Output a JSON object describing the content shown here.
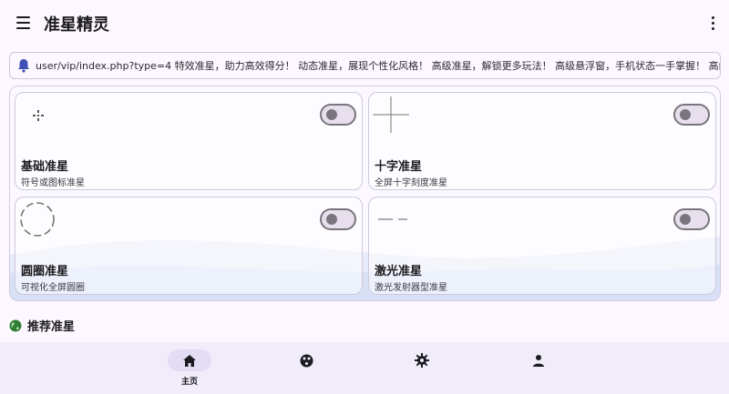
{
  "appbar": {
    "title": "准星精灵",
    "menu_icon": "menu-icon",
    "more_icon": "more-vert-icon"
  },
  "notice": {
    "icon": "bell-icon",
    "text": "user/vip/index.php?type=4 特效准星，助力高效得分！ 动态准星，展现个性化风格！ 高级准星，解锁更多玩法！ 高级悬浮窗，手机状态一手掌握！ 高级自定义诊"
  },
  "cards": [
    {
      "title": "基础准星",
      "subtitle": "符号或图标准星",
      "enabled": false
    },
    {
      "title": "十字准星",
      "subtitle": "全屏十字刻度准星",
      "enabled": false
    },
    {
      "title": "圆圈准星",
      "subtitle": "可视化全屏圆圈",
      "enabled": false
    },
    {
      "title": "激光准星",
      "subtitle": "激光发射器型准星",
      "enabled": false
    }
  ],
  "section": {
    "icon": "globe-icon",
    "title": "推荐准星"
  },
  "bottom_nav": {
    "items": [
      {
        "icon": "home-icon",
        "label": "主页",
        "active": true
      },
      {
        "icon": "palette-icon",
        "label": "",
        "active": false
      },
      {
        "icon": "settings-gear-icon",
        "label": "",
        "active": false
      },
      {
        "icon": "person-icon",
        "label": "",
        "active": false
      }
    ]
  },
  "colors": {
    "background": "#fdf8ff",
    "nav_background": "#f1ecfa",
    "accent_bell": "#3f51b5",
    "globe": "#2e7d32",
    "toggle_outline": "#79747e"
  }
}
